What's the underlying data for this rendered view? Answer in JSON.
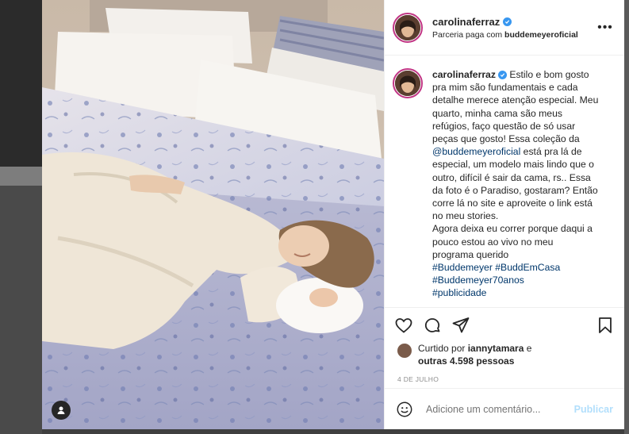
{
  "post": {
    "username": "carolinaferraz",
    "partnership_text": "Parceria paga com ",
    "partner_handle": "buddemeyeroficial",
    "more_glyph": "•••",
    "caption": {
      "username": "carolinaferraz",
      "lines": [
        "Estilo e bom gosto",
        "pra mim são fundamentais e cada",
        "detalhe merece atenção especial. Meu",
        "quarto, minha cama são meus",
        "refúgios, faço questão de só usar",
        "peças que gosto! Essa coleção da"
      ],
      "mention": "@buddemeyeroficial",
      "mention_tail": " está pra lá de",
      "lines2": [
        "especial, um modelo mais lindo que o",
        "outro, difícil é sair da cama, rs.. Essa",
        "da foto é o Paradiso, gostaram? Então",
        "corre lá no site e aproveite o link está",
        "no meu stories.",
        "Agora deixa eu correr porque daqui a",
        "pouco estou ao vivo no meu",
        "programa querido"
      ],
      "hashtags_line1": [
        "#Buddemeyer",
        "#BuddEmCasa"
      ],
      "hashtags_line2": "#Buddemeyer70anos",
      "hashtags_line3": "#publicidade"
    },
    "likes": {
      "prefix": "Curtido por ",
      "user": "iannytamara",
      "mid": " e",
      "others": "outras 4.598 pessoas"
    },
    "date": "4 DE JULHO",
    "comment": {
      "placeholder": "Adicione um comentário...",
      "post_label": "Publicar"
    },
    "icons": {
      "like": "heart-icon",
      "comment": "comment-icon",
      "share": "share-icon",
      "save": "bookmark-icon",
      "emoji": "emoji-icon",
      "user_tag": "user-tag-icon",
      "verified": "verified-icon"
    },
    "colors": {
      "verified": "#3897f0",
      "link": "#00376b",
      "muted": "#8e8e8e",
      "publish_disabled": "#b2dffc"
    }
  }
}
